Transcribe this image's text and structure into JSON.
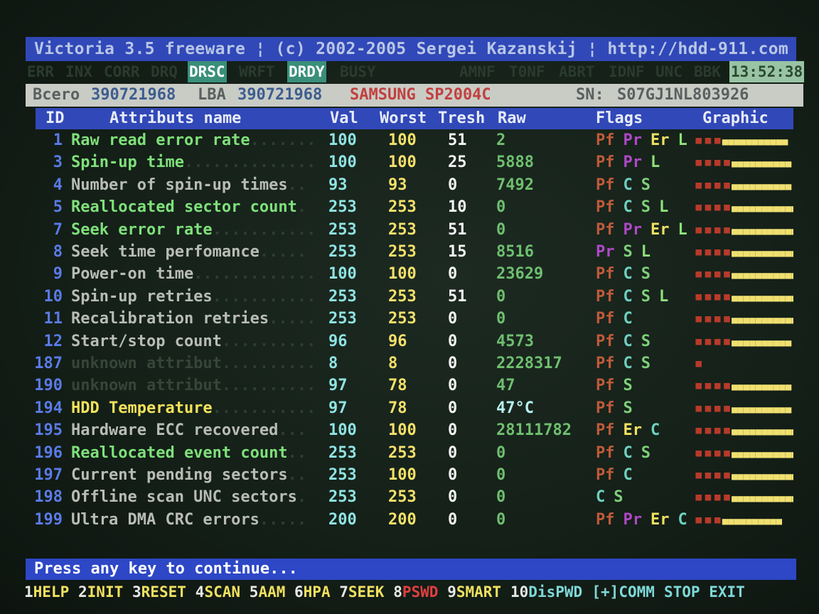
{
  "title": "Victoria 3.5 freeware ¦  (c) 2002-2005  Sergei Kazanskij  ¦ http://hdd-911.com",
  "status_flags": [
    {
      "label": "ERR",
      "on": false
    },
    {
      "label": "INX",
      "on": false
    },
    {
      "label": "CORR",
      "on": false
    },
    {
      "label": "DRQ",
      "on": false
    },
    {
      "label": "DRSC",
      "on": true
    },
    {
      "label": "WRFT",
      "on": false
    },
    {
      "label": "DRDY",
      "on": true
    },
    {
      "label": "BUSY",
      "on": false
    },
    {
      "label": "AMNF",
      "on": false
    },
    {
      "label": "T0NF",
      "on": false
    },
    {
      "label": "ABRT",
      "on": false
    },
    {
      "label": "IDNF",
      "on": false
    },
    {
      "label": "UNC",
      "on": false
    },
    {
      "label": "BBK",
      "on": false
    }
  ],
  "clock": "13:52:38",
  "info": {
    "total_label": "Bcero",
    "total_value": "390721968",
    "lba_label": "LBA",
    "lba_value": "390721968",
    "model": "SAMSUNG SP2004C",
    "sn_label": "SN:",
    "sn_value": "S07GJ1NL803926"
  },
  "columns": {
    "id": "ID",
    "name": "Attributs name",
    "val": "Val",
    "worst": "Worst",
    "tresh": "Tresh",
    "raw": "Raw",
    "flags": "Flags",
    "graphic": "Graphic"
  },
  "attributes": [
    {
      "id": "1",
      "name": "Raw read error rate",
      "dots": "..........",
      "style": "green",
      "val": "100",
      "worst": "100",
      "tresh": "51",
      "raw": "2",
      "flags": [
        "Pf",
        "Pr",
        "Er",
        "L"
      ],
      "graph_red": 3,
      "graph_yel": 11
    },
    {
      "id": "3",
      "name": "Spin-up time",
      "dots": ".................",
      "style": "green",
      "val": "100",
      "worst": "100",
      "tresh": "25",
      "raw": "5888",
      "flags": [
        "Pf",
        "Pr",
        "L"
      ],
      "graph_red": 4,
      "graph_yel": 10
    },
    {
      "id": "4",
      "name": "Number of spin-up times",
      "dots": "..",
      "style": "gray",
      "val": "93",
      "worst": "93",
      "tresh": "0",
      "raw": "7492",
      "flags": [
        "Pf",
        "C",
        "S"
      ],
      "graph_red": 4,
      "graph_yel": 10
    },
    {
      "id": "5",
      "name": "Reallocated sector count",
      "dots": ".",
      "style": "green",
      "val": "253",
      "worst": "253",
      "tresh": "10",
      "raw": "0",
      "flags": [
        "Pf",
        "C",
        "S",
        "L"
      ],
      "graph_red": 4,
      "graph_yel": 11
    },
    {
      "id": "7",
      "name": "Seek error rate",
      "dots": "..............",
      "style": "green",
      "val": "253",
      "worst": "253",
      "tresh": "51",
      "raw": "0",
      "flags": [
        "Pf",
        "Pr",
        "Er",
        "L"
      ],
      "graph_red": 4,
      "graph_yel": 11
    },
    {
      "id": "8",
      "name": "Seek time perfomance",
      "dots": ".....",
      "style": "gray",
      "val": "253",
      "worst": "253",
      "tresh": "15",
      "raw": "8516",
      "flags": [
        "Pr",
        "S",
        "L"
      ],
      "graph_red": 4,
      "graph_yel": 11
    },
    {
      "id": "9",
      "name": "Power-on time",
      "dots": "................",
      "style": "gray",
      "val": "100",
      "worst": "100",
      "tresh": "0",
      "raw": "23629",
      "flags": [
        "Pf",
        "C",
        "S"
      ],
      "graph_red": 4,
      "graph_yel": 11
    },
    {
      "id": "10",
      "name": "Spin-up retries",
      "dots": "..............",
      "style": "gray",
      "val": "253",
      "worst": "253",
      "tresh": "51",
      "raw": "0",
      "flags": [
        "Pf",
        "C",
        "S",
        "L"
      ],
      "graph_red": 4,
      "graph_yel": 11
    },
    {
      "id": "11",
      "name": "Recalibration retries",
      "dots": "........",
      "style": "gray",
      "val": "253",
      "worst": "253",
      "tresh": "0",
      "raw": "0",
      "flags": [
        "Pf",
        "C"
      ],
      "graph_red": 4,
      "graph_yel": 11
    },
    {
      "id": "12",
      "name": "Start/stop count",
      "dots": ".............",
      "style": "gray",
      "val": "96",
      "worst": "96",
      "tresh": "0",
      "raw": "4573",
      "flags": [
        "Pf",
        "C",
        "S"
      ],
      "graph_red": 4,
      "graph_yel": 10
    },
    {
      "id": "187",
      "name": "unknown attribut",
      "dots": ".............",
      "style": "dim",
      "val": "8",
      "worst": "8",
      "tresh": "0",
      "raw": "2228317",
      "flags": [
        "Pf",
        "C",
        "S"
      ],
      "graph_red": 1,
      "graph_yel": 0
    },
    {
      "id": "190",
      "name": "unknown attribut",
      "dots": ".............",
      "style": "dim",
      "val": "97",
      "worst": "78",
      "tresh": "0",
      "raw": "47",
      "flags": [
        "Pf",
        "S"
      ],
      "graph_red": 4,
      "graph_yel": 10
    },
    {
      "id": "194",
      "name": "HDD Temperature",
      "dots": "..............",
      "style": "yellow",
      "val": "97",
      "worst": "78",
      "tresh": "0",
      "raw": "47°C",
      "flags": [
        "Pf",
        "S"
      ],
      "graph_red": 4,
      "graph_yel": 10
    },
    {
      "id": "195",
      "name": "Hardware ECC recovered",
      "dots": "...",
      "style": "gray",
      "val": "100",
      "worst": "100",
      "tresh": "0",
      "raw": "28111782",
      "flags": [
        "Pf",
        "Er",
        "C"
      ],
      "graph_red": 4,
      "graph_yel": 11
    },
    {
      "id": "196",
      "name": "Reallocated event count",
      "dots": "..",
      "style": "green",
      "val": "253",
      "worst": "253",
      "tresh": "0",
      "raw": "0",
      "flags": [
        "Pf",
        "C",
        "S"
      ],
      "graph_red": 4,
      "graph_yel": 11
    },
    {
      "id": "197",
      "name": "Current pending sectors",
      "dots": "..",
      "style": "gray",
      "val": "253",
      "worst": "100",
      "tresh": "0",
      "raw": "0",
      "flags": [
        "Pf",
        "C"
      ],
      "graph_red": 4,
      "graph_yel": 11
    },
    {
      "id": "198",
      "name": "Offline scan UNC sectors",
      "dots": ".",
      "style": "gray",
      "val": "253",
      "worst": "253",
      "tresh": "0",
      "raw": "0",
      "flags": [
        "C",
        "S"
      ],
      "graph_red": 4,
      "graph_yel": 11
    },
    {
      "id": "199",
      "name": "Ultra DMA CRC errors",
      "dots": ".....",
      "style": "gray",
      "val": "200",
      "worst": "200",
      "tresh": "0",
      "raw": "0",
      "flags": [
        "Pf",
        "Pr",
        "Er",
        "C"
      ],
      "graph_red": 3,
      "graph_yel": 10
    }
  ],
  "prompt": "Press any key to continue...",
  "function_keys": [
    {
      "num": "1",
      "label": "HELP"
    },
    {
      "num": "2",
      "label": "INIT"
    },
    {
      "num": "3",
      "label": "RESET"
    },
    {
      "num": "4",
      "label": "SCAN"
    },
    {
      "num": "5",
      "label": "AAM"
    },
    {
      "num": "6",
      "label": "HPA"
    },
    {
      "num": "7",
      "label": "SEEK"
    },
    {
      "num": "8",
      "label": "PSWD"
    },
    {
      "num": "9",
      "label": "SMART"
    },
    {
      "num": "10",
      "label": "DisPWD"
    },
    {
      "num": "",
      "label": "[+]COMM"
    },
    {
      "num": "",
      "label": "STOP"
    },
    {
      "num": "",
      "label": "EXIT"
    }
  ],
  "colors": {
    "title_bg": "#3148b8",
    "header_bg": "#3148b8",
    "prompt_bg": "#2d47c6",
    "flag_on_bg": "#3a8f7a",
    "info_bg": "#c9ccc5"
  }
}
